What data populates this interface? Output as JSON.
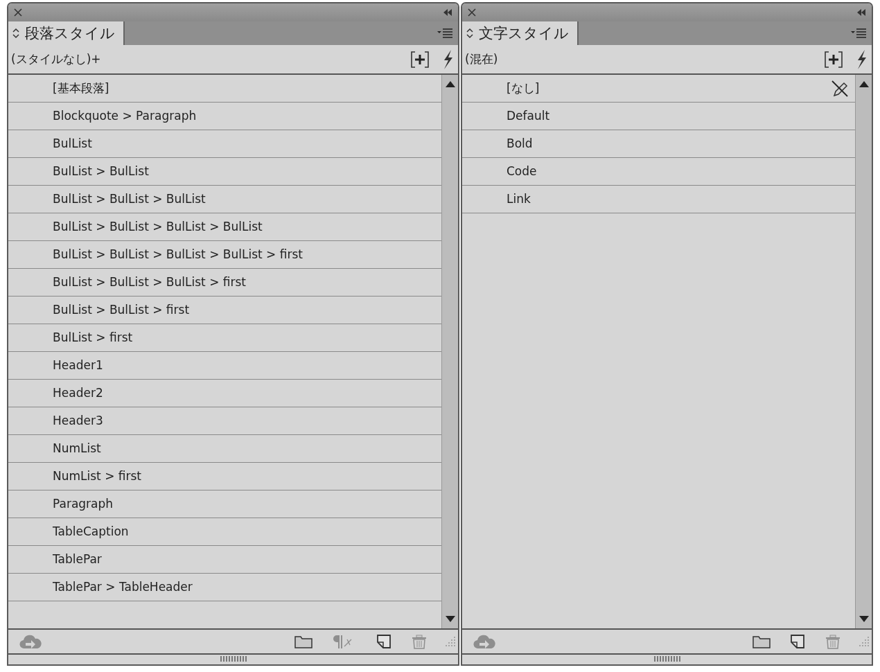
{
  "panels": [
    {
      "title": "段落スタイル",
      "current_style": "(スタイルなし)+",
      "items": [
        {
          "label": "[基本段落]",
          "locked": false
        },
        {
          "label": "Blockquote > Paragraph",
          "locked": false
        },
        {
          "label": "BulList",
          "locked": false
        },
        {
          "label": "BulList > BulList",
          "locked": false
        },
        {
          "label": "BulList > BulList > BulList",
          "locked": false
        },
        {
          "label": "BulList > BulList > BulList > BulList",
          "locked": false
        },
        {
          "label": "BulList > BulList > BulList > BulList > first",
          "locked": false
        },
        {
          "label": "BulList > BulList > BulList > first",
          "locked": false
        },
        {
          "label": "BulList > BulList > first",
          "locked": false
        },
        {
          "label": "BulList > first",
          "locked": false
        },
        {
          "label": "Header1",
          "locked": false
        },
        {
          "label": "Header2",
          "locked": false
        },
        {
          "label": "Header3",
          "locked": false
        },
        {
          "label": "NumList",
          "locked": false
        },
        {
          "label": "NumList > first",
          "locked": false
        },
        {
          "label": "Paragraph",
          "locked": false
        },
        {
          "label": "TableCaption",
          "locked": false
        },
        {
          "label": "TablePar",
          "locked": false
        },
        {
          "label": "TablePar > TableHeader",
          "locked": false
        }
      ],
      "tools": [
        {
          "kind": "cloud",
          "disabled": true
        },
        {
          "kind": "folder",
          "disabled": false
        },
        {
          "kind": "clear",
          "disabled": true
        },
        {
          "kind": "new",
          "disabled": false
        },
        {
          "kind": "trash",
          "disabled": true
        }
      ]
    },
    {
      "title": "文字スタイル",
      "current_style": "(混在)",
      "items": [
        {
          "label": "[なし]",
          "locked": true
        },
        {
          "label": "Default",
          "locked": false
        },
        {
          "label": "Bold",
          "locked": false
        },
        {
          "label": "Code",
          "locked": false
        },
        {
          "label": "Link",
          "locked": false
        }
      ],
      "tools": [
        {
          "kind": "cloud",
          "disabled": true
        },
        {
          "kind": "folder",
          "disabled": false
        },
        {
          "kind": "new",
          "disabled": false
        },
        {
          "kind": "trash",
          "disabled": true
        }
      ]
    }
  ]
}
